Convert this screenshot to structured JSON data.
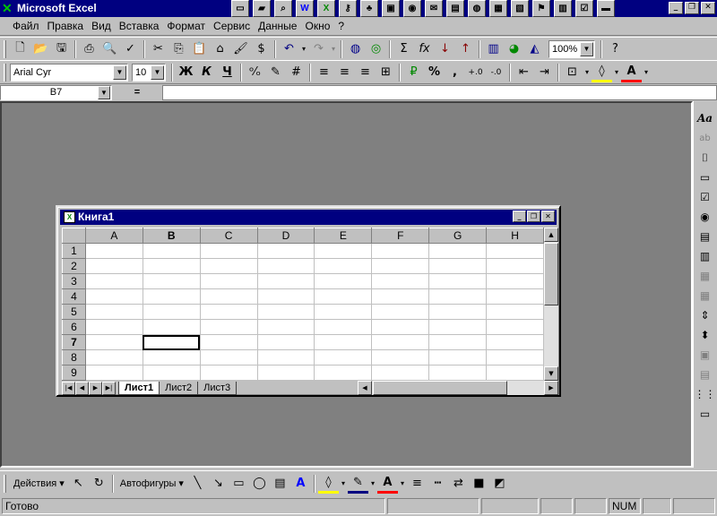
{
  "app": {
    "title": "Microsoft Excel",
    "logo_icon": "excel-x-icon"
  },
  "taskbar_icons": [
    "doc-icon",
    "folder-icon",
    "chart-icon",
    "word-icon",
    "excel-icon",
    "key-icon",
    "tree-icon",
    "monitor-icon",
    "media-icon",
    "mail-icon",
    "book-icon",
    "globe-icon",
    "notes-icon",
    "image-icon",
    "flag-icon",
    "calendar-icon",
    "checklist-icon",
    "window-icon"
  ],
  "window_buttons": {
    "minimize": "_",
    "restore": "❐",
    "close": "✕"
  },
  "menu": [
    "Файл",
    "Правка",
    "Вид",
    "Вставка",
    "Формат",
    "Сервис",
    "Данные",
    "Окно",
    "?"
  ],
  "standard_toolbar": {
    "zoom": "100%"
  },
  "format_toolbar": {
    "font": "Arial Cyr",
    "size": "10",
    "bold": "Ж",
    "italic": "К",
    "underline": "Ч",
    "percent": "%",
    "comma": ","
  },
  "formula_bar": {
    "name_box": "B7",
    "equals": "="
  },
  "workbook": {
    "title": "Книга1",
    "columns": [
      "A",
      "B",
      "C",
      "D",
      "E",
      "F",
      "G",
      "H"
    ],
    "rows": [
      "1",
      "2",
      "3",
      "4",
      "5",
      "6",
      "7",
      "8",
      "9"
    ],
    "active_cell": "B7",
    "sheets": [
      "Лист1",
      "Лист2",
      "Лист3"
    ],
    "active_sheet": "Лист1"
  },
  "drawing_toolbar": {
    "actions": "Действия",
    "autoshapes": "Автофигуры"
  },
  "status": {
    "ready": "Готово",
    "num": "NUM"
  },
  "colors": {
    "title_bar": "#000080",
    "workspace": "#808080",
    "face": "#c0c0c0",
    "fill_color": "#ffff00",
    "font_color": "#ff0000"
  }
}
